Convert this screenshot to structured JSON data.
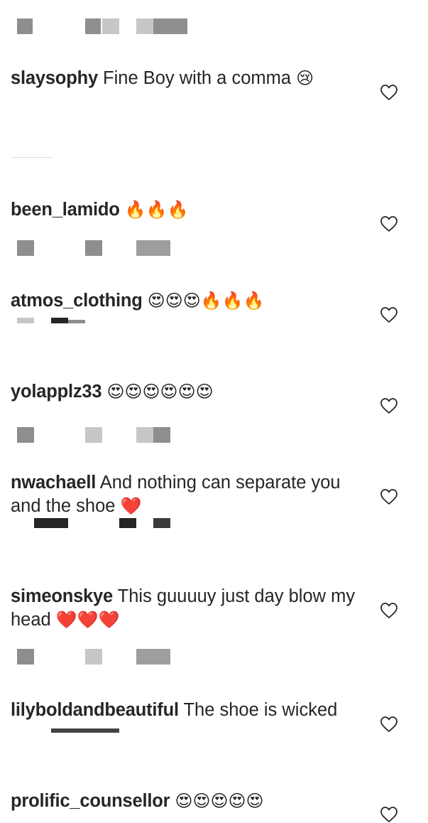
{
  "comments": [
    {
      "username": "slaysophy",
      "text": "Fine Boy with a comma",
      "emoji": "😢"
    },
    {
      "username": "been_lamido",
      "text": "",
      "emoji": "🔥🔥🔥"
    },
    {
      "username": "atmos_clothing",
      "text": "",
      "emoji": "😍😍😍🔥🔥🔥"
    },
    {
      "username": "yolapplz33",
      "text": "",
      "emoji": "😍😍😍😍😍😍"
    },
    {
      "username": "nwachaell",
      "text": "And nothing can separate you and the shoe",
      "emoji": "❤️"
    },
    {
      "username": "simeonskye",
      "text": "This guuuuy just day blow my head",
      "emoji": "❤️❤️❤️"
    },
    {
      "username": "lilyboldandbeautiful",
      "text": "The shoe is wicked",
      "emoji": ""
    },
    {
      "username": "prolific_counsellor",
      "text": "",
      "emoji": "😍😍😍😍😍"
    }
  ],
  "icons": {
    "like": "heart-outline-icon"
  },
  "colors": {
    "text": "#262626",
    "secondary": "#8e8e8e"
  }
}
